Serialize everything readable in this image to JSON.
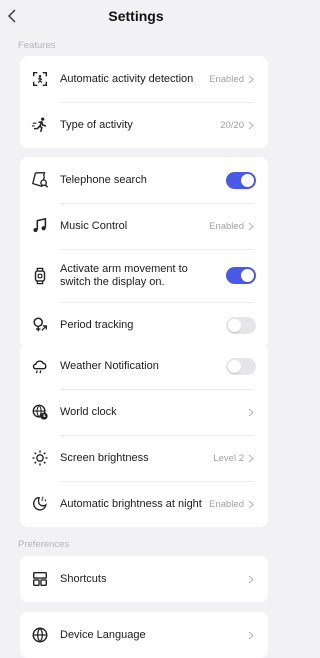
{
  "header": {
    "title": "Settings"
  },
  "sections": {
    "features": "Features",
    "preferences": "Preferences"
  },
  "colors": {
    "accent": "#4a5ae8",
    "toggle_off": "#e6e6ea",
    "background": "#f2f2f4"
  },
  "features": {
    "auto_detect": {
      "label": "Automatic activity detection",
      "value": "Enabled",
      "icon": "activity-detection-icon"
    },
    "activity_type": {
      "label": "Type of activity",
      "value": "20/20",
      "icon": "running-icon"
    },
    "telephone_search": {
      "label": "Telephone search",
      "enabled": true,
      "icon": "phone-search-icon"
    },
    "music_control": {
      "label": "Music Control",
      "value": "Enabled",
      "icon": "music-note-icon"
    },
    "arm_movement": {
      "label": "Activate arm movement to switch the display on.",
      "enabled": true,
      "icon": "watch-icon"
    },
    "period_tracking": {
      "label": "Period tracking",
      "enabled": false,
      "icon": "period-tracking-icon"
    },
    "weather": {
      "label": "Weather Notification",
      "enabled": false,
      "icon": "weather-icon"
    },
    "world_clock": {
      "label": "World clock",
      "value": "",
      "icon": "world-clock-icon"
    },
    "brightness": {
      "label": "Screen brightness",
      "value": "Level 2",
      "icon": "sun-icon"
    },
    "night_brightness": {
      "label": "Automatic brightness at night",
      "value": "Enabled",
      "icon": "night-brightness-icon"
    }
  },
  "preferences": {
    "shortcuts": {
      "label": "Shortcuts",
      "icon": "shortcuts-icon"
    },
    "language": {
      "label": "Device Language",
      "icon": "globe-icon"
    }
  }
}
